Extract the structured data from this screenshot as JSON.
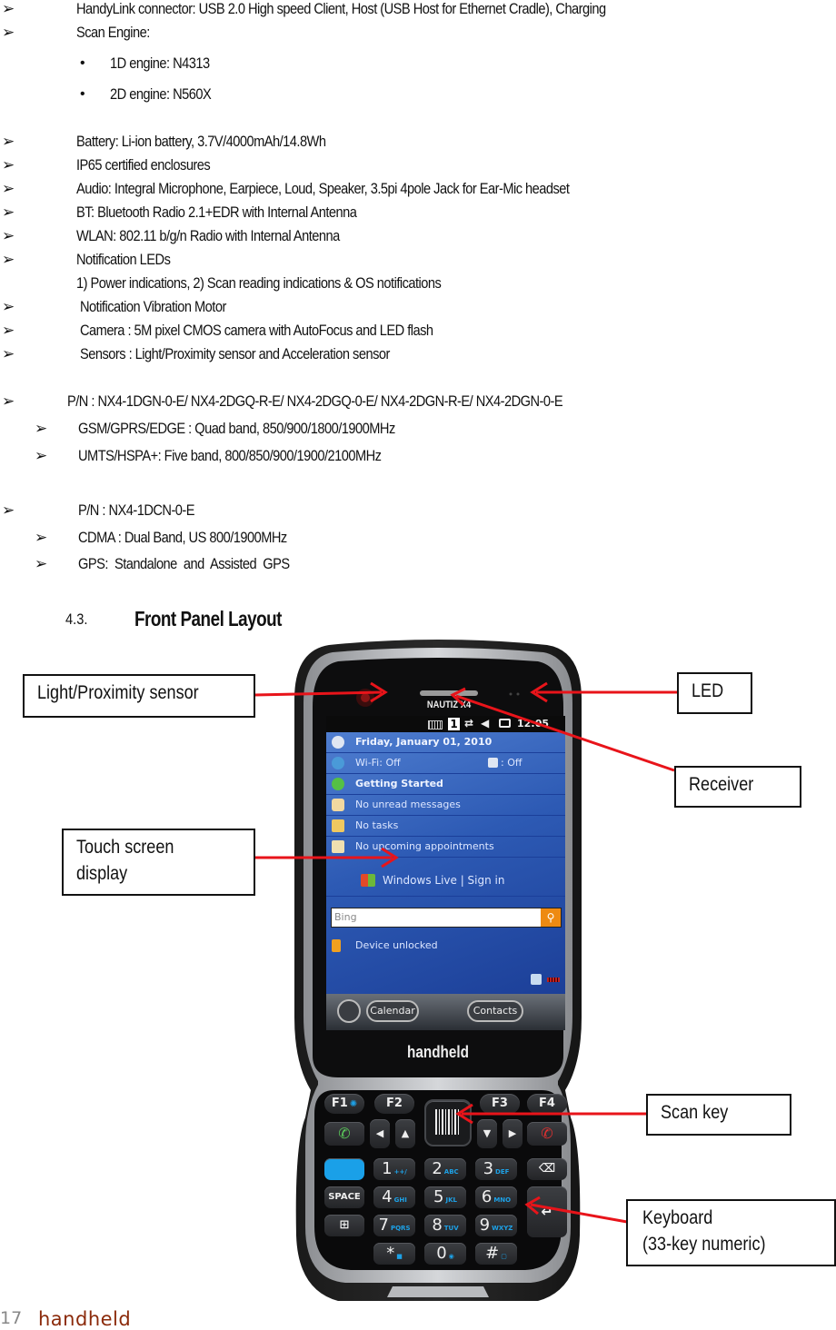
{
  "specs": {
    "items": [
      {
        "marker": "arrow",
        "text": "HandyLink connector: USB 2.0 High speed Client, Host (USB Host for Ethernet Cradle),     Charging"
      },
      {
        "marker": "arrow",
        "text": "Scan Engine:"
      },
      {
        "marker": "bullet",
        "text": "1D engine: N4313"
      },
      {
        "marker": "bullet",
        "text": "2D engine: N560X"
      },
      {
        "marker": "arrow",
        "text": "Battery: Li-ion battery, 3.7V/4000mAh/14.8Wh"
      },
      {
        "marker": "arrow",
        "text": "IP65 certified enclosures"
      },
      {
        "marker": "arrow",
        "text": "Audio: Integral Microphone, Earpiece, Loud, Speaker, 3.5pi 4pole Jack for Ear-Mic headset"
      },
      {
        "marker": "arrow",
        "text": "BT: Bluetooth Radio 2.1+EDR with Internal Antenna"
      },
      {
        "marker": "arrow",
        "text": "WLAN: 802.11 b/g/n Radio with Internal Antenna"
      },
      {
        "marker": "arrow",
        "text": "Notification LEDs"
      },
      {
        "marker": "none",
        "text": "1) Power indications, 2) Scan reading indications & OS notifications"
      },
      {
        "marker": "arrow",
        "text": "Notification Vibration Motor"
      },
      {
        "marker": "arrow",
        "text": "Camera : 5M pixel CMOS camera with AutoFocus and LED flash"
      },
      {
        "marker": "arrow",
        "text": "Sensors : Light/Proximity sensor and Acceleration sensor"
      }
    ],
    "pn_group_1": {
      "title": "P/N : NX4-1DGN-0-E/ NX4-2DGQ-R-E/ NX4-2DGQ-0-E/ NX4-2DGN-R-E/ NX4-2DGN-0-E",
      "sub": [
        "GSM/GPRS/EDGE : Quad band, 850/900/1800/1900MHz",
        "UMTS/HSPA+: Five band, 800/850/900/1900/2100MHz"
      ]
    },
    "pn_group_2": {
      "title": "P/N : NX4-1DCN-0-E",
      "sub": [
        "CDMA : Dual Band, US 800/1900MHz",
        "GPS:  Standalone  and  Assisted  GPS"
      ]
    },
    "arrow_glyph": "➢",
    "bullet_glyph": "•"
  },
  "section": {
    "number": "4.3.",
    "title": "Front Panel Layout"
  },
  "callouts": {
    "light_sensor": "Light/Proximity sensor",
    "led": "LED",
    "receiver": "Receiver",
    "touch_screen_line1": "Touch screen",
    "touch_screen_line2": "display",
    "scan_key": "Scan key",
    "keyboard_line1": "Keyboard",
    "keyboard_line2": "(33-key numeric)"
  },
  "device": {
    "model_label": "NAUTIZ X4",
    "brand_label": "handheld",
    "status_bar": {
      "line_indicator": "1",
      "time": "12:05"
    },
    "screen_rows": [
      {
        "text": "Friday, January 01, 2010",
        "bold": true,
        "icon": "clock-icon"
      },
      {
        "text": "Wi-Fi: Off",
        "right": ": Off",
        "bold": false,
        "icon": "wifi-icon"
      },
      {
        "text": "Getting Started",
        "bold": true,
        "icon": "check-icon"
      },
      {
        "text": "No unread messages",
        "bold": false,
        "icon": "mail-icon"
      },
      {
        "text": "No tasks",
        "bold": false,
        "icon": "tasks-icon"
      },
      {
        "text": "No upcoming appointments",
        "bold": false,
        "icon": "calendar-icon"
      }
    ],
    "windows_live": "Windows Live | Sign in",
    "search_placeholder": "Bing",
    "device_status": "Device unlocked",
    "softkeys": {
      "left": "Calendar",
      "right": "Contacts"
    },
    "keys": {
      "f1": "F1",
      "f2": "F2",
      "f3": "F3",
      "f4": "F4",
      "space": "SPACE",
      "digits": [
        {
          "d": "1",
          "s": "++/"
        },
        {
          "d": "2",
          "s": "ABC"
        },
        {
          "d": "3",
          "s": "DEF"
        },
        {
          "d": "4",
          "s": "GHI"
        },
        {
          "d": "5",
          "s": "JKL"
        },
        {
          "d": "6",
          "s": "MNO"
        },
        {
          "d": "7",
          "s": "PQRS"
        },
        {
          "d": "8",
          "s": "TUV"
        },
        {
          "d": "9",
          "s": "WXYZ"
        },
        {
          "d": "*",
          "s": "■"
        },
        {
          "d": "0",
          "s": "◉"
        },
        {
          "d": "#",
          "s": "▢"
        }
      ]
    }
  },
  "footer": {
    "page_number": "17",
    "brand": "handheld"
  }
}
